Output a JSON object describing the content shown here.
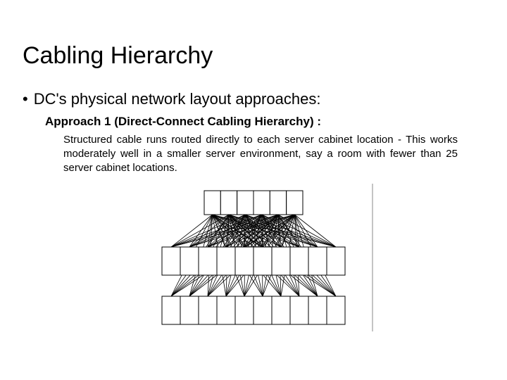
{
  "title": "Cabling Hierarchy",
  "bullet": {
    "text": "DC's physical network layout approaches:"
  },
  "approach": {
    "heading": "Approach 1 (Direct-Connect Cabling Hierarchy) :",
    "body": "Structured cable runs routed directly to each server cabinet location - This works moderately well in a smaller server environment, say a room with fewer than 25 server cabinet locations."
  },
  "diagram": {
    "top_boxes": 6,
    "mid_boxes": 10,
    "bot_boxes": 10
  }
}
